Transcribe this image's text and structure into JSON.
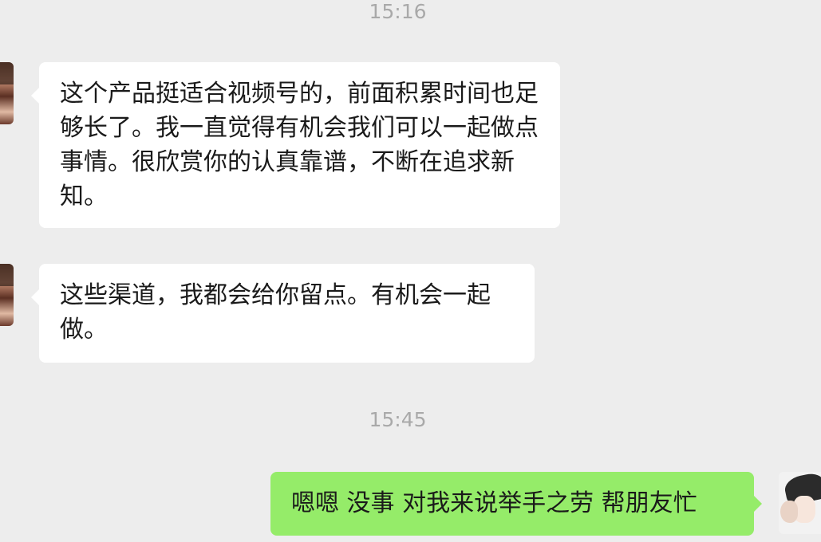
{
  "timestamps": {
    "first": "15:16",
    "second": "15:45"
  },
  "messages": [
    {
      "sender": "contact",
      "text": "这个产品挺适合视频号的，前面积累时间也足够长了。我一直觉得有机会我们可以一起做点事情。很欣赏你的认真靠谱，不断在追求新知。"
    },
    {
      "sender": "contact",
      "text": "这些渠道，我都会给你留点。有机会一起做。"
    },
    {
      "sender": "self",
      "text": "嗯嗯 没事   对我来说举手之劳 帮朋友忙"
    }
  ],
  "colors": {
    "background": "#ededed",
    "incoming_bubble": "#ffffff",
    "outgoing_bubble": "#95ec69",
    "timestamp": "#a9a9a9"
  },
  "icons": {
    "contact_avatar": "contact-avatar-icon",
    "self_avatar": "self-avatar-icon"
  }
}
